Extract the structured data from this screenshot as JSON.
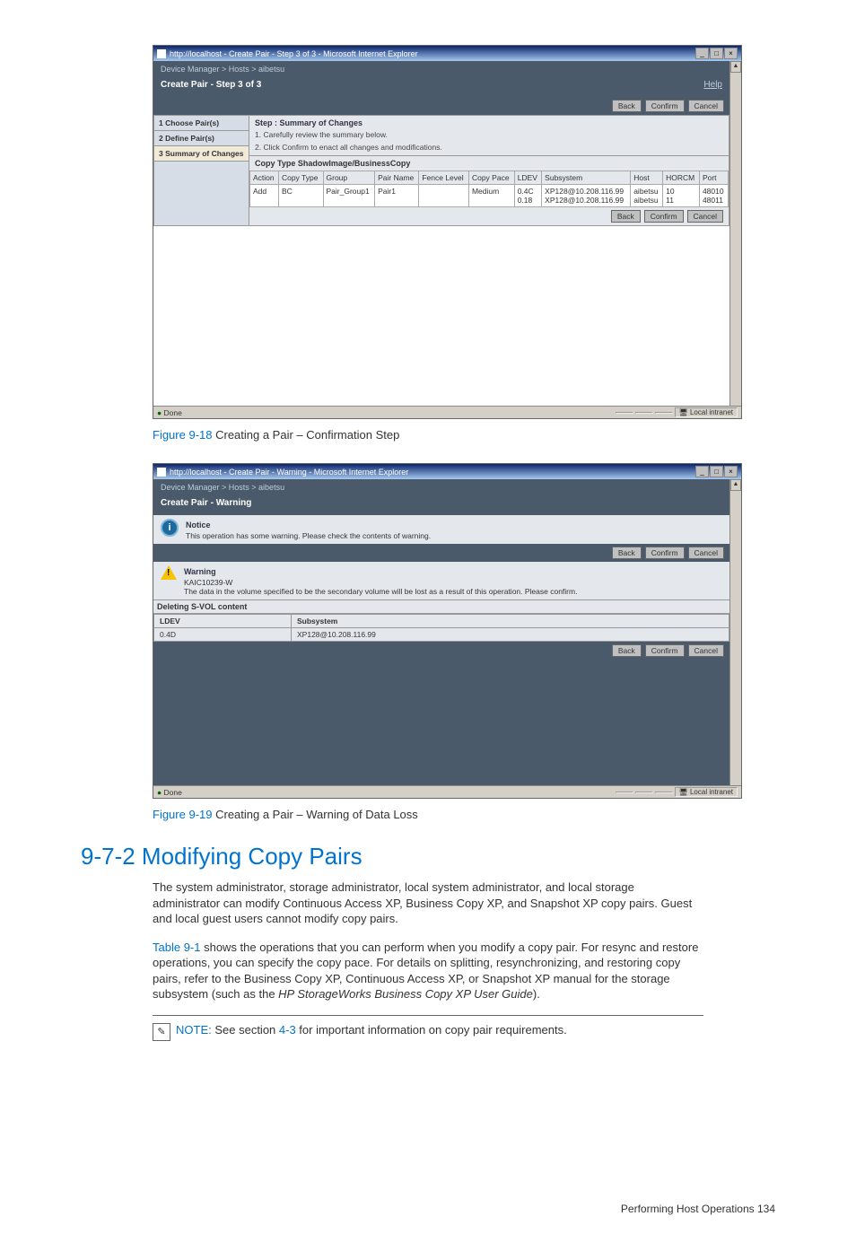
{
  "shot1": {
    "window_title": "http://localhost - Create Pair - Step 3 of 3 - Microsoft Internet Explorer",
    "breadcrumb": "Device Manager > Hosts > aibetsu",
    "page_title": "Create Pair - Step 3 of 3",
    "help_link": "Help",
    "btn_back": "Back",
    "btn_confirm": "Confirm",
    "btn_cancel": "Cancel",
    "steps": {
      "s1": "1 Choose Pair(s)",
      "s2": "2 Define Pair(s)",
      "s3": "3 Summary of Changes"
    },
    "step_title": "Step : Summary of Changes",
    "note1": "1. Carefully review the summary below.",
    "note2": "2. Click Confirm to enact all changes and modifications.",
    "section": "Copy Type ShadowImage/BusinessCopy",
    "columns": {
      "c0": "Action",
      "c1": "Copy Type",
      "c2": "Group",
      "c3": "Pair Name",
      "c4": "Fence Level",
      "c5": "Copy Pace",
      "c6": "LDEV",
      "c7": "Subsystem",
      "c8": "Host",
      "c9": "HORCM",
      "c10": "Port"
    },
    "row": {
      "action": "Add",
      "copytype": "BC",
      "group": "Pair_Group1",
      "pairname": "Pair1",
      "fence": "",
      "pace": "Medium",
      "ldev1": "0.4C",
      "ldev2": "0.18",
      "subsys1": "XP128@10.208.116.99",
      "subsys2": "XP128@10.208.116.99",
      "host1": "aibetsu",
      "host2": "aibetsu",
      "horcm1": "10",
      "horcm2": "11",
      "port1": "48010",
      "port2": "48011"
    },
    "status_done": "Done",
    "status_zone": "Local intranet"
  },
  "caption1": {
    "ref": "Figure 9-18",
    "text": " Creating a Pair – Confirmation Step"
  },
  "shot2": {
    "window_title": "http://localhost - Create Pair - Warning - Microsoft Internet Explorer",
    "breadcrumb": "Device Manager > Hosts > aibetsu",
    "page_title": "Create Pair - Warning",
    "notice_title": "Notice",
    "notice_text": "This operation has some warning. Please check the contents of warning.",
    "btn_back": "Back",
    "btn_confirm": "Confirm",
    "btn_cancel": "Cancel",
    "warning_title": "Warning",
    "warning_code": "KAIC10239-W",
    "warning_text": "The data in the volume specified to be the secondary volume will be lost as a result of this operation. Please confirm.",
    "deleting": "Deleting S-VOL content",
    "col_ldev": "LDEV",
    "col_sub": "Subsystem",
    "val_ldev": "0.4D",
    "val_sub": "XP128@10.208.116.99",
    "status_done": "Done",
    "status_zone": "Local intranet"
  },
  "caption2": {
    "ref": "Figure 9-19",
    "text": " Creating a Pair – Warning of Data Loss"
  },
  "section_heading": "9-7-2 Modifying Copy Pairs",
  "para1": "The system administrator, storage administrator, local system administrator, and local storage administrator can modify Continuous Access XP, Business Copy XP, and Snapshot XP copy pairs. Guest and local guest users cannot modify copy pairs.",
  "para2_link": "Table 9-1",
  "para2_a": " shows the operations that you can perform when you modify a copy pair. For resync and restore operations, you can specify the copy pace. For details on splitting, resynchronizing, and restoring copy pairs, refer to the Business Copy XP, Continuous Access XP, or Snapshot XP manual for the storage subsystem (such as the ",
  "para2_italic": "HP StorageWorks Business Copy XP User Guide",
  "para2_b": ").",
  "note_label": "NOTE:",
  "note_text_a": "  See section ",
  "note_link": "4-3",
  "note_text_b": " for important information on copy pair requirements.",
  "footer": "Performing Host Operations    134"
}
